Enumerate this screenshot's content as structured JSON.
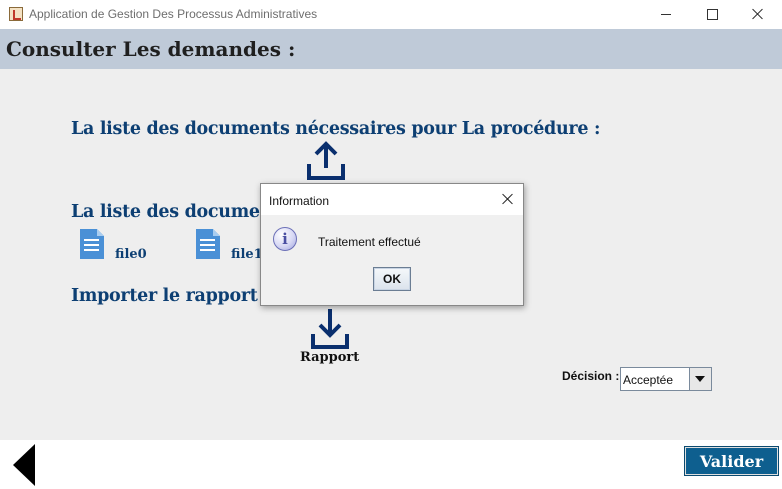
{
  "window": {
    "title": "Application de Gestion Des Processus Administratives"
  },
  "header": {
    "title": "Consulter Les demandes :"
  },
  "sections": {
    "required_docs": "La liste des documents nécessaires pour La procédure :",
    "docs_list": "La liste des documents",
    "import_report": "Importer le rapport"
  },
  "files": [
    {
      "name": "file0",
      "icon": "document-icon"
    },
    {
      "name": "file1",
      "icon": "document-icon"
    }
  ],
  "icons": {
    "upload": "upload-icon",
    "download": "download-icon",
    "back": "back-arrow-icon",
    "info": "info-icon"
  },
  "rapport": {
    "label": "Rapport"
  },
  "decision": {
    "label": "Décision :",
    "value": "Acceptée"
  },
  "footer": {
    "submit_label": "Valider"
  },
  "dialog": {
    "title": "Information",
    "message": "Traitement effectué",
    "ok_label": "OK",
    "info_glyph": "i"
  },
  "colors": {
    "header_bg": "#bfcad8",
    "section_text": "#0d3f73",
    "submit_bg": "#0e5f8f",
    "icon_navy": "#0a2f6e"
  }
}
